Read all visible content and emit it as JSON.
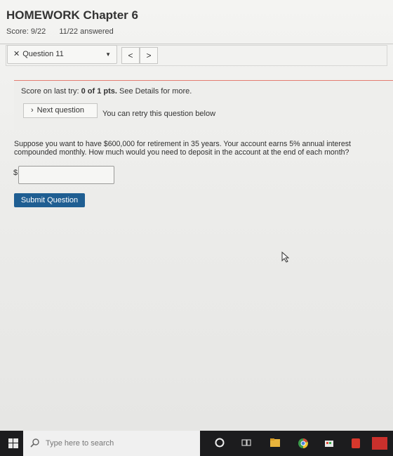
{
  "header": {
    "title": "HOMEWORK Chapter 6",
    "score": "Score: 9/22",
    "answered": "11/22 answered"
  },
  "question_nav": {
    "selected": "Question 11",
    "prev_label": "<",
    "next_label": ">"
  },
  "feedback": {
    "prefix": "Score on last try: ",
    "score": "0 of 1 pts.",
    "suffix": " See Details for more.",
    "next_button": "Next question",
    "retry_text": "You can retry this question below"
  },
  "question": {
    "text": "Suppose you want to have $600,000 for retirement in 35 years. Your account earns 5% annual interest compounded monthly. How much would you need to deposit in the account at the end of each month?",
    "currency_symbol": "$",
    "answer_value": "",
    "submit_label": "Submit Question"
  },
  "taskbar": {
    "search_placeholder": "Type here to search",
    "icons": [
      "windows-start-icon",
      "search-icon",
      "cortana-icon",
      "task-view-icon",
      "file-explorer-icon",
      "chrome-icon",
      "store-icon",
      "app-icon"
    ]
  },
  "colors": {
    "accent": "#1f5e92",
    "feedback_rule": "#e37c72",
    "taskbar": "#1c1c1e"
  }
}
